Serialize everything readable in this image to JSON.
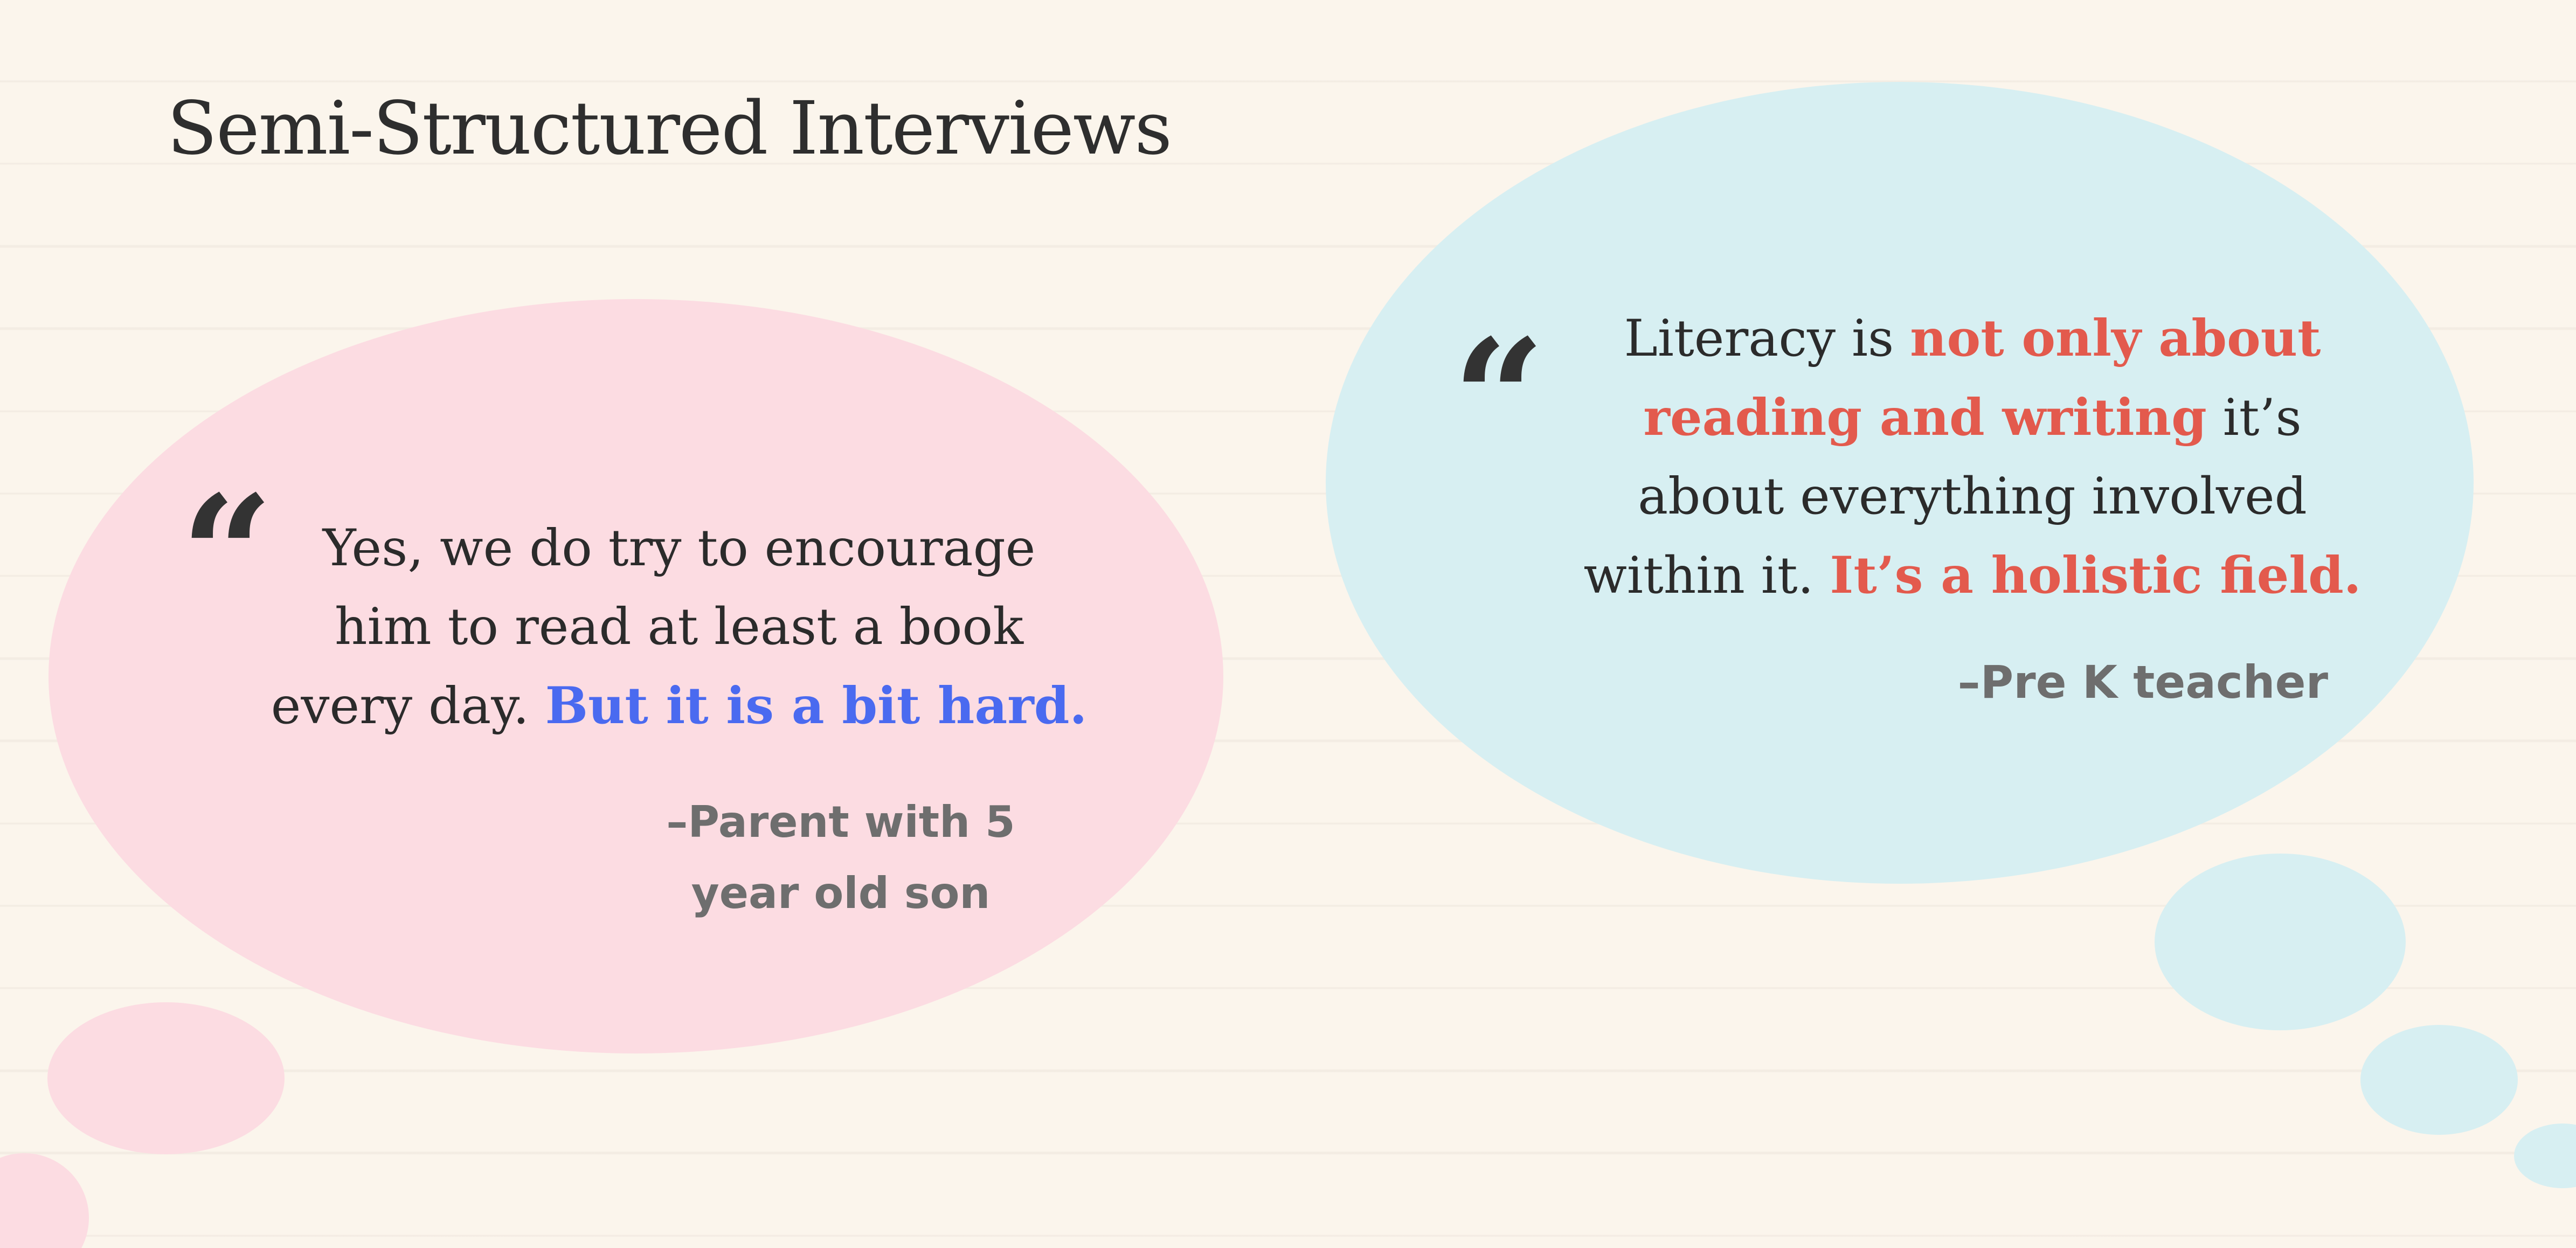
{
  "slide": {
    "title": "Semi-Structured Interviews"
  },
  "quotes": [
    {
      "icon": "quote-mark-icon",
      "glyph": "“",
      "lines": [
        {
          "text": "Yes, we do try to encourage"
        },
        {
          "text": "him to read at least a book"
        },
        {
          "pre": "every day. ",
          "highlight": "But it is a bit hard."
        }
      ],
      "highlight_color": "#4a6af0",
      "attribution_lines": [
        "–Parent with 5",
        "year old son"
      ]
    },
    {
      "icon": "quote-mark-icon",
      "glyph": "“",
      "lines": [
        {
          "pre": "Literacy is ",
          "highlight": "not only about"
        },
        {
          "highlight": "reading and writing",
          "post": " it’s"
        },
        {
          "text": "about everything involved"
        },
        {
          "pre": "within it. ",
          "highlight": "It’s a holistic field."
        }
      ],
      "highlight_color": "#e35a4d",
      "attribution_lines": [
        "–Pre K teacher"
      ]
    }
  ],
  "colors": {
    "background": "#fbf5ec",
    "pink_bubble": "#fcdce2",
    "blue_bubble": "#d7eff2",
    "body_text": "#2b2b2b",
    "attribution_text": "#6e6e6e"
  }
}
